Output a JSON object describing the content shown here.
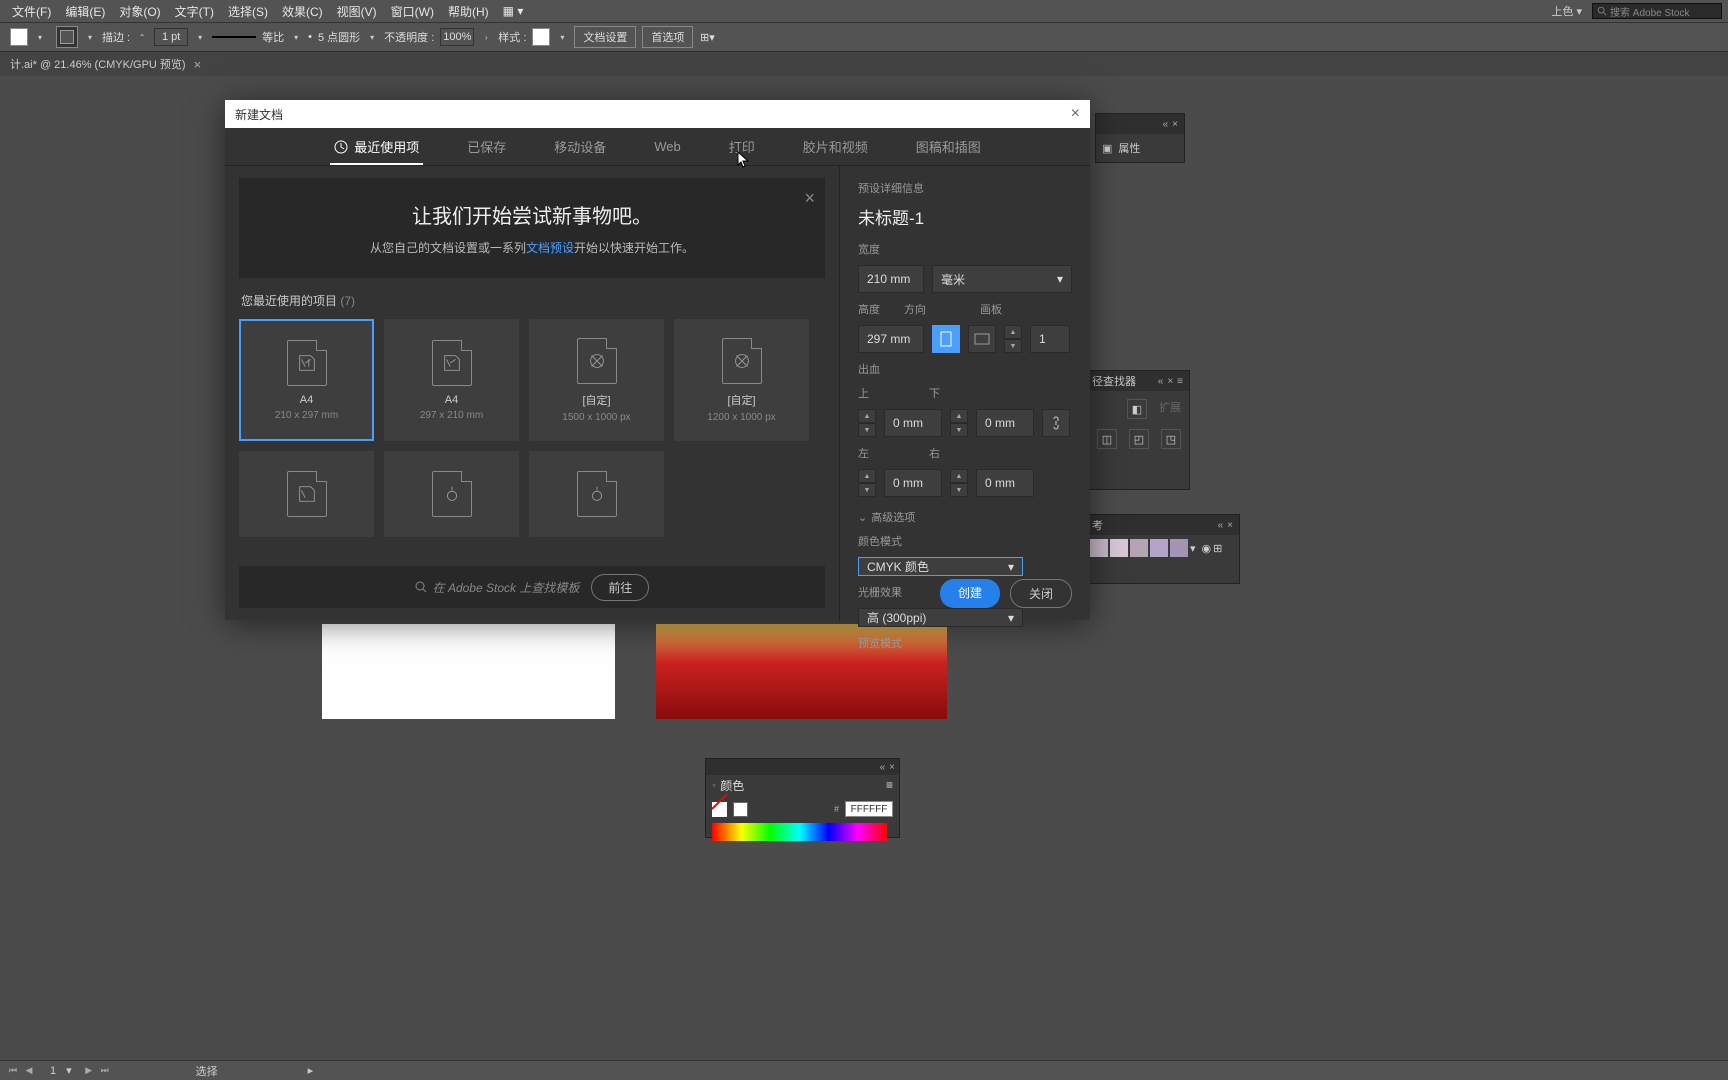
{
  "menu": {
    "file": "文件(F)",
    "edit": "编辑(E)",
    "object": "对象(O)",
    "type": "文字(T)",
    "select": "选择(S)",
    "effect": "效果(C)",
    "view": "视图(V)",
    "window": "窗口(W)",
    "help": "帮助(H)",
    "colorize": "上色",
    "search": "搜索 Adobe Stock"
  },
  "ctrl": {
    "stroke": "描边 :",
    "pt": "1 pt",
    "ratio": "等比",
    "dash": "5 点圆形",
    "opacity": "不透明度 :",
    "opval": "100%",
    "style": "样式 :",
    "docset": "文档设置",
    "prefs": "首选项"
  },
  "doc": {
    "tab": "计.ai* @ 21.46% (CMYK/GPU 预览)"
  },
  "status": {
    "page": "1",
    "sel": "选择"
  },
  "panels": {
    "props": "属性",
    "path": "径查找器",
    "expand": "扩展",
    "colorref": "考"
  },
  "colorpanel": {
    "title": "颜色",
    "hex": "FFFFFF"
  },
  "modal": {
    "title": "新建文档",
    "tabs": {
      "recent": "最近使用项",
      "saved": "已保存",
      "mobile": "移动设备",
      "web": "Web",
      "print": "打印",
      "film": "胶片和视频",
      "art": "图稿和插图"
    },
    "banner": {
      "h": "让我们开始尝试新事物吧。",
      "p1": "从您自己的文档设置或一系列",
      "link": "文档预设",
      "p2": "开始以快速开始工作。"
    },
    "recent_label": "您最近使用的项目",
    "recent_count": "(7)",
    "cards": [
      {
        "name": "A4",
        "size": "210 x 297 mm"
      },
      {
        "name": "A4",
        "size": "297 x 210 mm"
      },
      {
        "name": "[自定]",
        "size": "1500 x 1000 px"
      },
      {
        "name": "[自定]",
        "size": "1200 x 1000 px"
      }
    ],
    "search_ph": "在 Adobe Stock 上查找模板",
    "go": "前往",
    "preset": {
      "info": "预设详细信息",
      "name": "未标题-1",
      "width_l": "宽度",
      "width": "210 mm",
      "unit": "毫米",
      "height_l": "高度",
      "height": "297 mm",
      "orient_l": "方向",
      "artboard_l": "画板",
      "artboards": "1",
      "bleed_l": "出血",
      "top": "上",
      "bottom": "下",
      "left": "左",
      "right": "右",
      "zero": "0 mm",
      "adv": "高级选项",
      "colormode_l": "颜色模式",
      "colormode": "CMYK 颜色",
      "raster_l": "光栅效果",
      "raster": "高 (300ppi)",
      "preview_l": "预览模式",
      "create": "创建",
      "close": "关闭"
    }
  }
}
